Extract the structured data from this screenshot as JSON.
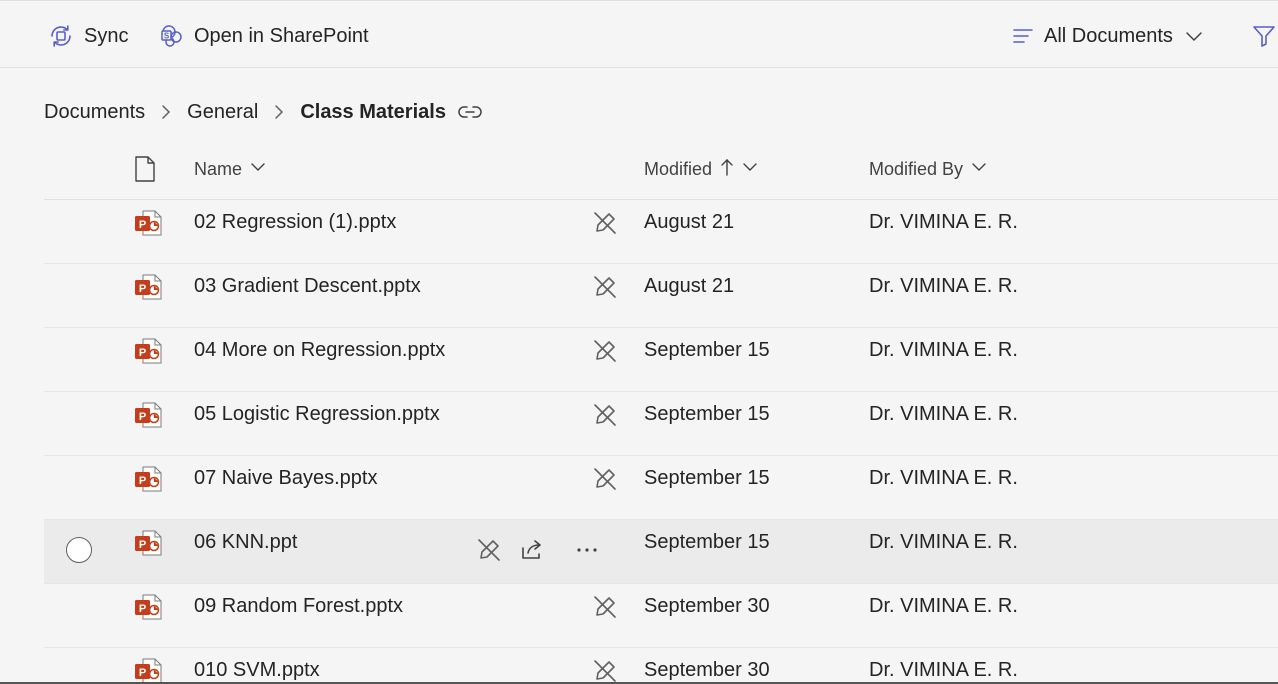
{
  "toolbar": {
    "sync_label": "Sync",
    "sharepoint_label": "Open in SharePoint",
    "view_label": "All Documents"
  },
  "breadcrumb": {
    "items": [
      "Documents",
      "General"
    ],
    "current": "Class Materials"
  },
  "columns": {
    "name": "Name",
    "modified": "Modified",
    "modified_by": "Modified By"
  },
  "files": [
    {
      "name": "02 Regression (1).pptx",
      "modified": "August 21",
      "modified_by": "Dr. VIMINA E. R."
    },
    {
      "name": "03 Gradient Descent.pptx",
      "modified": "August 21",
      "modified_by": "Dr. VIMINA E. R."
    },
    {
      "name": "04 More on Regression.pptx",
      "modified": "September 15",
      "modified_by": "Dr. VIMINA E. R."
    },
    {
      "name": "05 Logistic Regression.pptx",
      "modified": "September 15",
      "modified_by": "Dr. VIMINA E. R."
    },
    {
      "name": "07 Naive Bayes.pptx",
      "modified": "September 15",
      "modified_by": "Dr. VIMINA E. R."
    },
    {
      "name": "06 KNN.ppt",
      "modified": "September 15",
      "modified_by": "Dr. VIMINA E. R.",
      "hovered": true
    },
    {
      "name": "09 Random Forest.pptx",
      "modified": "September 30",
      "modified_by": "Dr. VIMINA E. R."
    },
    {
      "name": "010 SVM.pptx",
      "modified": "September 30",
      "modified_by": "Dr. VIMINA E. R."
    }
  ],
  "icons": {
    "sync": "sync-icon",
    "sharepoint": "sharepoint-icon",
    "view": "lines-icon",
    "filter": "filter-icon",
    "file_type": "powerpoint-icon",
    "no_edit": "pencil-strike-icon"
  },
  "colors": {
    "accent": "#5b5fc7",
    "powerpoint": "#c43e1c",
    "background": "#f5f5f5"
  }
}
